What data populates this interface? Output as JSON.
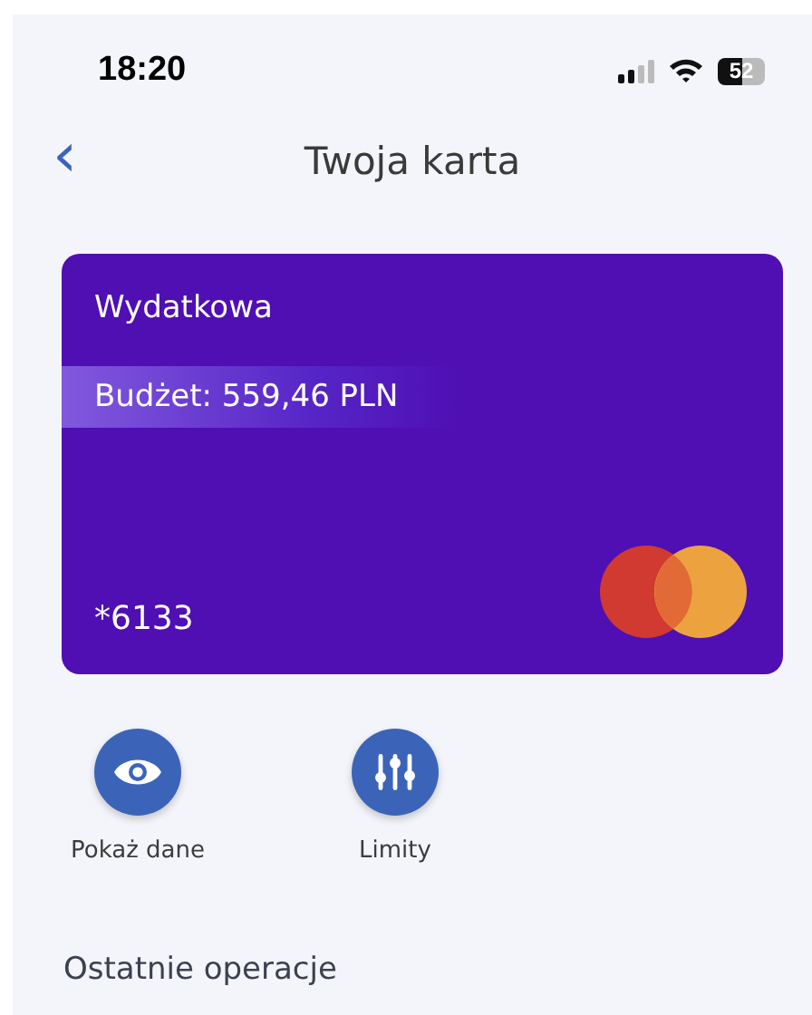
{
  "status_bar": {
    "time": "18:20",
    "battery": "52"
  },
  "header": {
    "back": "‹",
    "title": "Twoja karta"
  },
  "card": {
    "name": "Wydatkowa",
    "budget": "Budżet: 559,46 PLN",
    "number": "*6133"
  },
  "actions": [
    {
      "kind": "eye",
      "label": "Pokaż dane"
    },
    {
      "kind": "sliders",
      "label": "Limity"
    }
  ],
  "section_title": "Ostatnie operacje"
}
